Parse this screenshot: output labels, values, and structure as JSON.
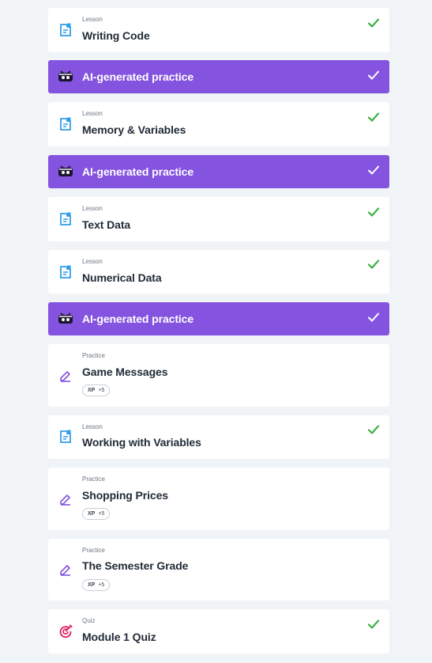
{
  "items": [
    {
      "type": "Lesson",
      "title": "Writing Code",
      "done": true
    },
    {
      "ai": true,
      "title": "AI-generated practice",
      "done": true
    },
    {
      "type": "Lesson",
      "title": "Memory & Variables",
      "done": true
    },
    {
      "ai": true,
      "title": "AI-generated practice",
      "done": true
    },
    {
      "type": "Lesson",
      "title": "Text Data",
      "done": true
    },
    {
      "type": "Lesson",
      "title": "Numerical Data",
      "done": true
    },
    {
      "ai": true,
      "title": "AI-generated practice",
      "done": true
    },
    {
      "type": "Practice",
      "title": "Game Messages",
      "xp_label": "XP",
      "xp_value": "+5"
    },
    {
      "type": "Lesson",
      "title": "Working with Variables",
      "done": true
    },
    {
      "type": "Practice",
      "title": "Shopping Prices",
      "xp_label": "XP",
      "xp_value": "+5"
    },
    {
      "type": "Practice",
      "title": "The Semester Grade",
      "xp_label": "XP",
      "xp_value": "+5"
    },
    {
      "type": "Quiz",
      "title": "Module 1 Quiz",
      "done": true
    }
  ],
  "colors": {
    "ai_bg": "#8453e0",
    "check_green": "#3cb043",
    "lesson_icon": "#2f9ee8",
    "practice_icon": "#8453e0",
    "quiz_icon": "#e0195c"
  }
}
